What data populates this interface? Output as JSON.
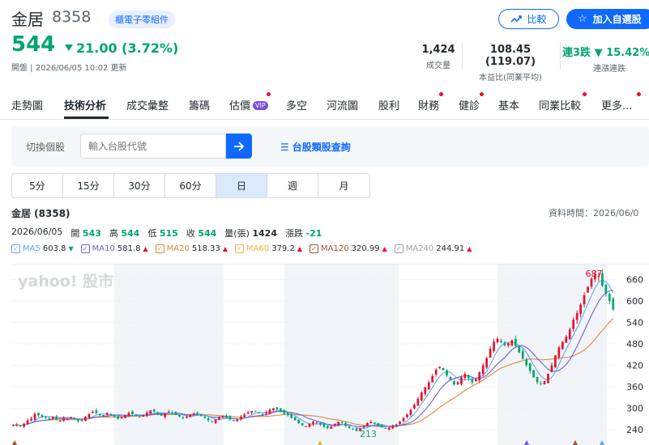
{
  "header": {
    "name": "金居",
    "code": "8358",
    "tag": "櫃電子零組件",
    "price": "544",
    "change": "21.00 (3.72%)",
    "status": "開盤 | 2026/06/05 10:02 更新"
  },
  "buttons": {
    "compare": "比較",
    "add": "加入自選股"
  },
  "stats": [
    {
      "value": "1,424",
      "label": "成交量"
    },
    {
      "value": "108.45 (119.07)",
      "label": "本益比(同業平均)"
    },
    {
      "value": "連3跌 ▼ 15.42%",
      "label": "連漲連跌"
    }
  ],
  "nav": [
    "走勢圖",
    "技術分析",
    "成交彙整",
    "籌碼",
    "估價",
    "多空",
    "河流圖",
    "股利",
    "財務",
    "健診",
    "基本",
    "同業比較",
    "更多..."
  ],
  "nav_vip": "VIP",
  "search": {
    "label": "切換個股",
    "placeholder": "輸入台股代號",
    "query_link": "台股類股查詢"
  },
  "periods": [
    "5分",
    "15分",
    "30分",
    "60分",
    "日",
    "週",
    "月"
  ],
  "selected_period": "日",
  "chart_header": {
    "title": "金居 (8358)",
    "data_time": "資料時間：2026/06/0"
  },
  "ohlc": {
    "date": "2026/06/05",
    "open_label": "開",
    "open": "543",
    "high_label": "高",
    "high": "544",
    "low_label": "低",
    "low": "515",
    "close_label": "收",
    "close": "544",
    "volume_label": "量(張)",
    "volume": "1424",
    "chg_label": "漲跌",
    "chg": "-21"
  },
  "ma": [
    {
      "name": "MA5",
      "value": "603.8",
      "dir": "down",
      "color": "#5fa8e8"
    },
    {
      "name": "MA10",
      "value": "581.8",
      "dir": "up",
      "color": "#6b5fd8"
    },
    {
      "name": "MA20",
      "value": "518.33",
      "dir": "up",
      "color": "#e6843b"
    },
    {
      "name": "MA60",
      "value": "379.2",
      "dir": "up",
      "color": "#f0b63a"
    },
    {
      "name": "MA120",
      "value": "320.99",
      "dir": "up",
      "color": "#a0522d"
    },
    {
      "name": "MA240",
      "value": "244.91",
      "dir": "up",
      "color": "#9aa0a6"
    }
  ],
  "chart_data": {
    "type": "candlestick",
    "watermark": "yahoo! 股市",
    "y_ticks": [
      660,
      600,
      540,
      480,
      420,
      360,
      300,
      240
    ],
    "ylim": [
      215,
      695
    ],
    "max_label": "687",
    "min_label": "213",
    "close_series": [
      252,
      254,
      250,
      256,
      266,
      271,
      284,
      280,
      276,
      273,
      270,
      276,
      268,
      265,
      272,
      270,
      275,
      269,
      264,
      267,
      276,
      283,
      290,
      286,
      281,
      277,
      286,
      282,
      276,
      270,
      274,
      281,
      287,
      283,
      279,
      276,
      281,
      288,
      294,
      290,
      284,
      279,
      284,
      290,
      286,
      281,
      276,
      272,
      276,
      281,
      286,
      284,
      278,
      272,
      266,
      262,
      268,
      274,
      278,
      274,
      268,
      264,
      269,
      276,
      282,
      288,
      292,
      290,
      286,
      282,
      288,
      296,
      300,
      296,
      290,
      284,
      280,
      273,
      266,
      258,
      252,
      249,
      256,
      262,
      260,
      254,
      248,
      244,
      248,
      256,
      262,
      258,
      250,
      245,
      240,
      236,
      243,
      250,
      258,
      262,
      256,
      250,
      246,
      243,
      246,
      250,
      254,
      262,
      272,
      283,
      296,
      310,
      326,
      344,
      358,
      372,
      390,
      408,
      416,
      406,
      392,
      378,
      366,
      372,
      386,
      396,
      384,
      372,
      382,
      400,
      420,
      440,
      466,
      486,
      494,
      484,
      476,
      482,
      490,
      474,
      456,
      438,
      420,
      404,
      386,
      372,
      368,
      376,
      396,
      420,
      448,
      470,
      486,
      500,
      520,
      548,
      566,
      590,
      616,
      640,
      662,
      676,
      670,
      642,
      620,
      600,
      576
    ],
    "colors": {
      "up": "#eb0f29",
      "down": "#00a56e"
    }
  }
}
